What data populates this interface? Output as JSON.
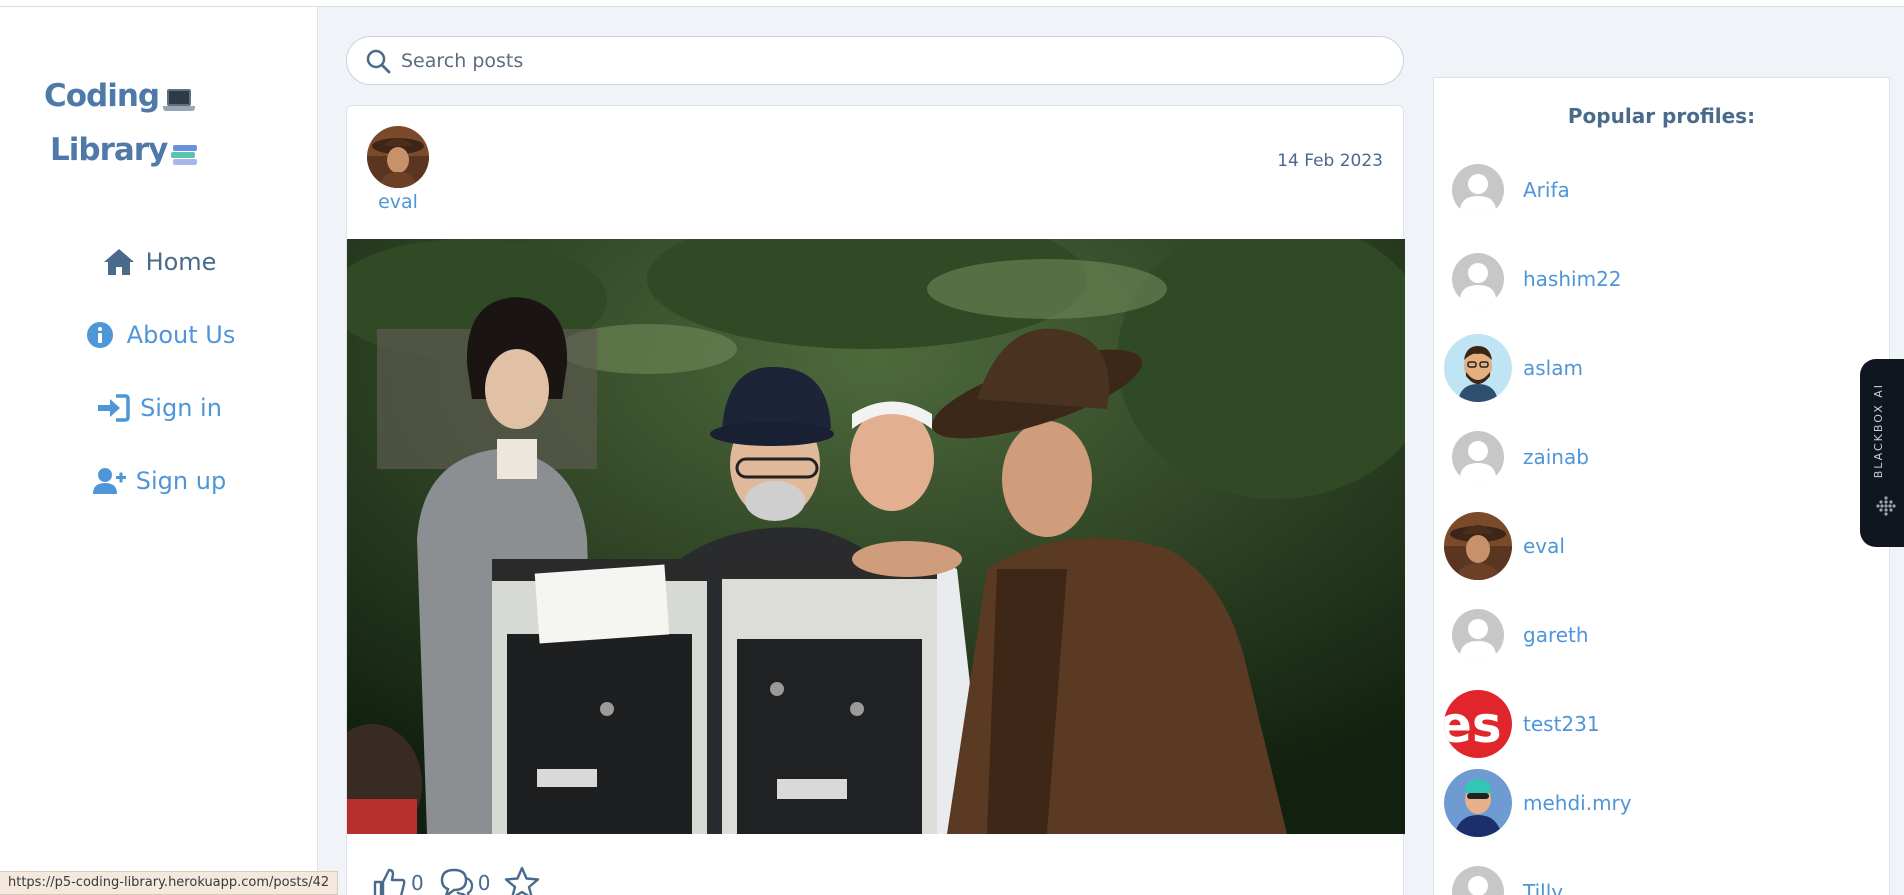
{
  "brand": {
    "line1": "Coding",
    "line2": "Library"
  },
  "nav": [
    {
      "label": "Home",
      "icon": "home-icon"
    },
    {
      "label": "About Us",
      "icon": "info-icon"
    },
    {
      "label": "Sign in",
      "icon": "sign-in-icon"
    },
    {
      "label": "Sign up",
      "icon": "user-plus-icon"
    }
  ],
  "search": {
    "placeholder": "Search posts"
  },
  "post": {
    "author": "eval",
    "date": "14 Feb 2023",
    "likes": "0",
    "comments": "0"
  },
  "profiles": {
    "title": "Popular profiles:",
    "items": [
      {
        "name": "Arifa",
        "avatar": "default"
      },
      {
        "name": "hashim22",
        "avatar": "default"
      },
      {
        "name": "aslam",
        "avatar": "cartoon"
      },
      {
        "name": "zainab",
        "avatar": "default"
      },
      {
        "name": "eval",
        "avatar": "photo"
      },
      {
        "name": "gareth",
        "avatar": "default"
      },
      {
        "name": "test231",
        "avatar": "text"
      },
      {
        "name": "mehdi.mry",
        "avatar": "swimmer"
      },
      {
        "name": "Tilly",
        "avatar": "default"
      }
    ]
  },
  "extension": {
    "label": "BLACKBOX AI"
  },
  "status_bar": {
    "url": "https://p5-coding-library.herokuapp.com/posts/42"
  },
  "colors": {
    "accent": "#4f96d8",
    "text": "#4a6a8c",
    "background": "#f0f3f8"
  }
}
